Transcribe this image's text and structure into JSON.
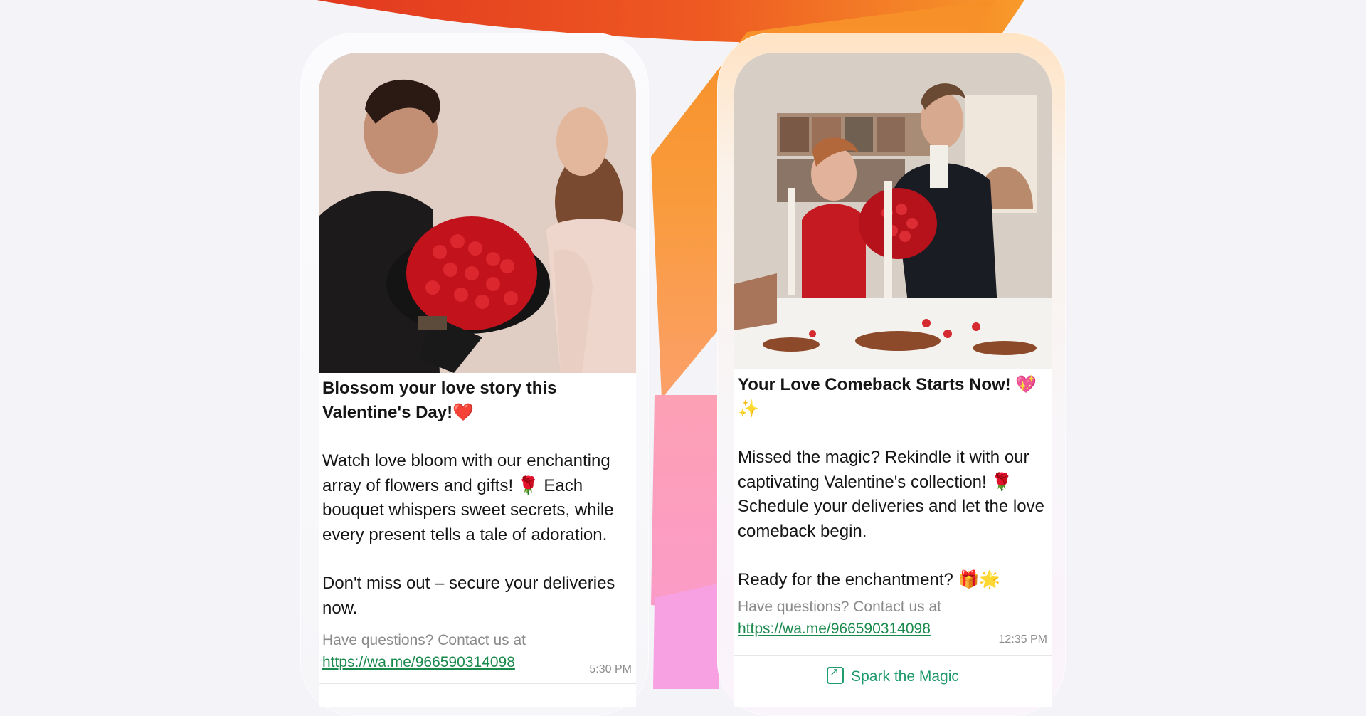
{
  "messages": [
    {
      "image_alt": "Man presenting a large bouquet of red roses to a woman",
      "title": "Blossom your love story this Valentine's Day!❤️",
      "paragraphs": [
        "Watch love bloom with our enchanting array of flowers and gifts! 🌹 Each bouquet whispers sweet secrets, while every present tells a tale of adoration.",
        "Don't miss out – secure your deliveries now."
      ],
      "contact_prefix": "Have questions? Contact us at ",
      "contact_link": "https://wa.me/966590314098",
      "time": "5:30 PM"
    },
    {
      "image_alt": "Couple at a candlelit dinner table with a bouquet of red roses",
      "title": "Your Love Comeback Starts Now! 💖✨",
      "paragraphs": [
        "Missed the magic? Rekindle it with our captivating Valentine's collection! 🌹 Schedule your deliveries and let the love comeback begin.",
        "Ready for the enchantment? 🎁🌟"
      ],
      "contact_prefix": "Have questions? Contact us at ",
      "contact_link": "https://wa.me/966590314098",
      "time": "12:35 PM",
      "cta_label": "Spark the Magic",
      "cta_icon": "external-link-icon"
    }
  ],
  "colors": {
    "link": "#1a8a4c",
    "cta": "#1f9a6a",
    "accent_orange": "#f7941d",
    "accent_red": "#e8442a",
    "accent_pink": "#f79ad6"
  }
}
